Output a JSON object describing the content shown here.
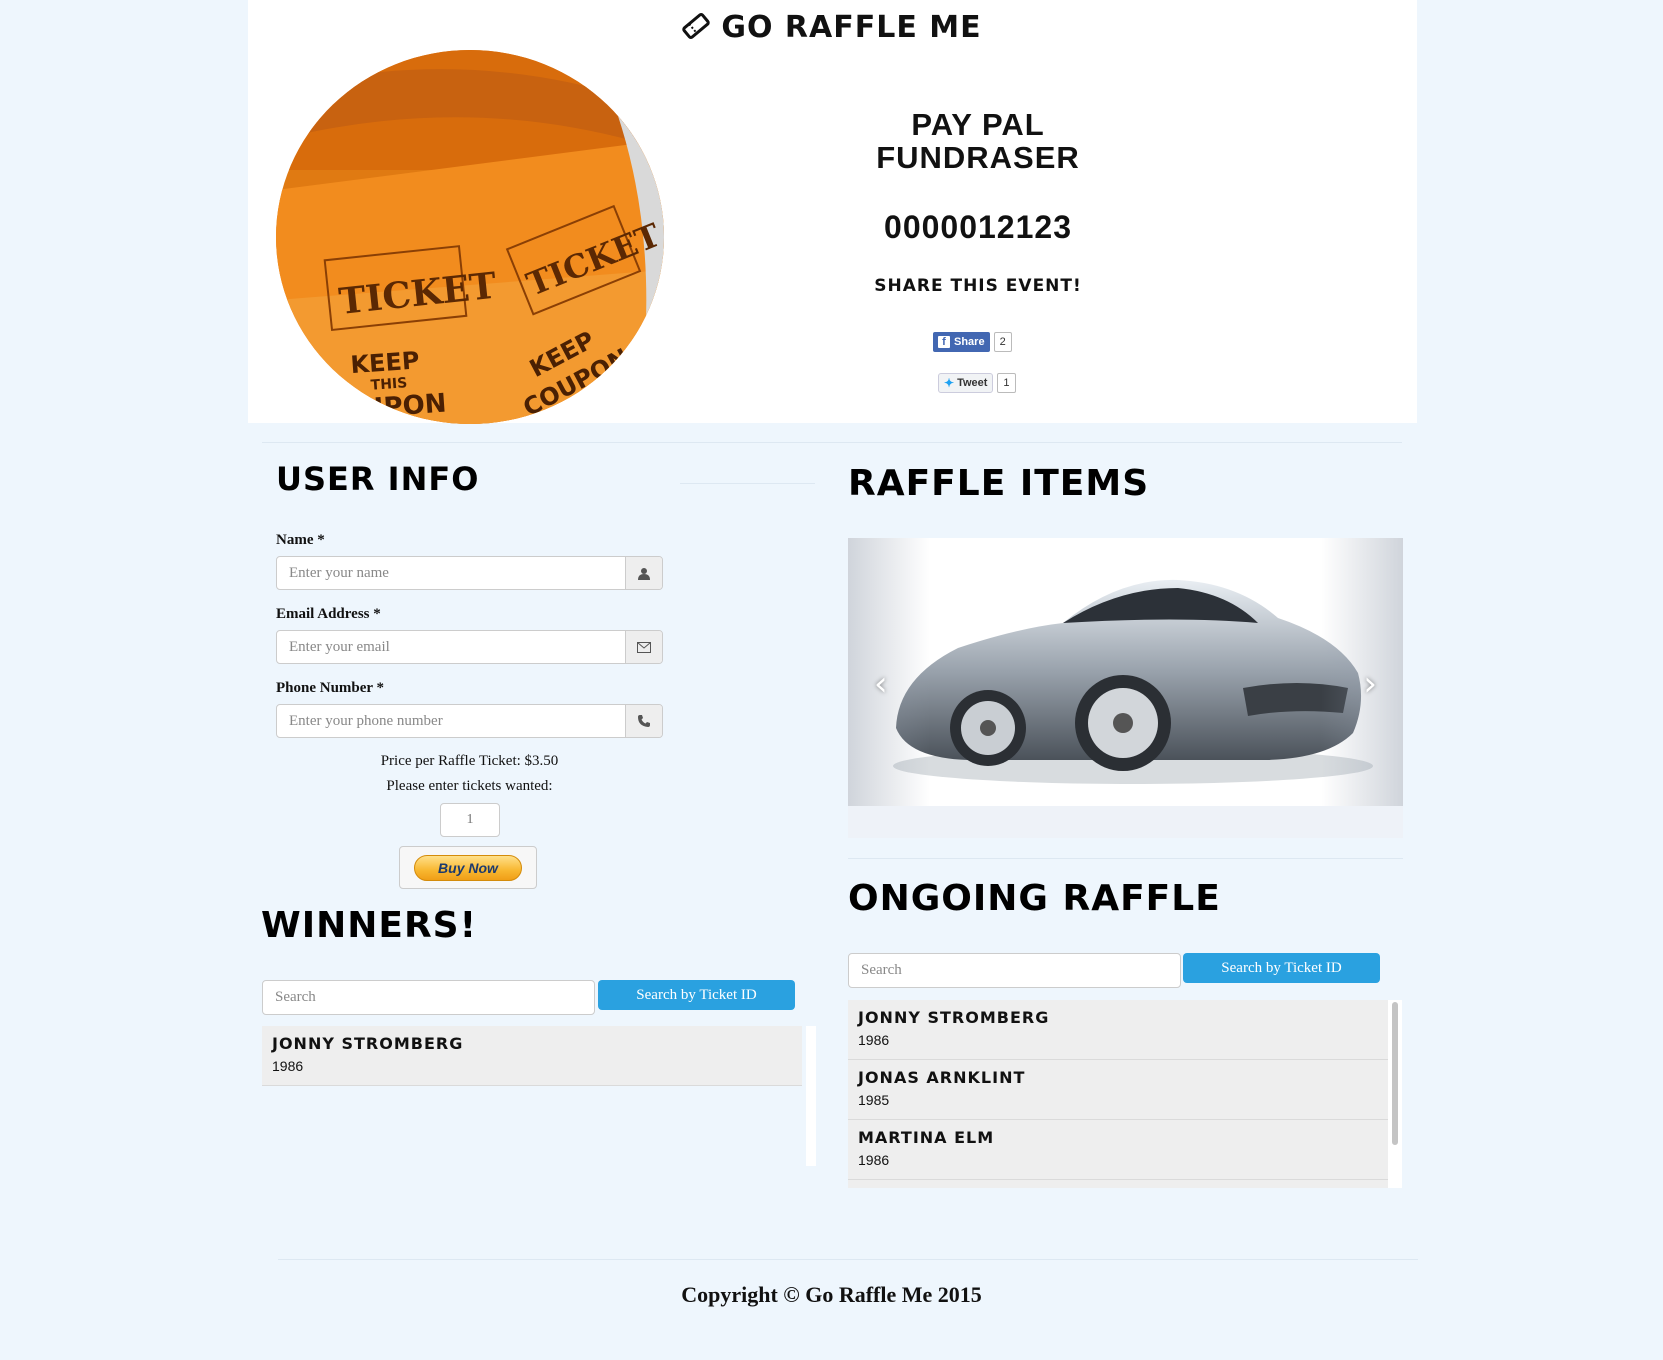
{
  "brand": {
    "name": "GO RAFFLE ME"
  },
  "event": {
    "title_line1": "PAY PAL",
    "title_line2": "FUNDRASER",
    "number": "0000012123",
    "share_heading": "SHARE THIS EVENT!",
    "share": {
      "label": "Share",
      "count": "2"
    },
    "tweet": {
      "label": "Tweet",
      "count": "1"
    }
  },
  "user_info": {
    "heading": "USER INFO",
    "name": {
      "label": "Name *",
      "placeholder": "Enter your name"
    },
    "email": {
      "label": "Email Address *",
      "placeholder": "Enter your email"
    },
    "phone": {
      "label": "Phone Number *",
      "placeholder": "Enter your phone number"
    },
    "price_text": "Price per Raffle Ticket: $3.50",
    "tickets_prompt": "Please enter tickets wanted:",
    "tickets_value": "1",
    "buy_label": "Buy Now"
  },
  "winners": {
    "heading": "WINNERS!",
    "search_placeholder": "Search",
    "search_button": "Search by Ticket ID",
    "items": [
      {
        "name": "JONNY STROMBERG",
        "year": "1986"
      }
    ]
  },
  "raffle_items": {
    "heading": "RAFFLE ITEMS"
  },
  "ongoing": {
    "heading": "ONGOING RAFFLE",
    "search_placeholder": "Search",
    "search_button": "Search by Ticket ID",
    "items": [
      {
        "name": "JONNY STROMBERG",
        "year": "1986"
      },
      {
        "name": "JONAS ARNKLINT",
        "year": "1985"
      },
      {
        "name": "MARTINA ELM",
        "year": "1986"
      }
    ]
  },
  "footer": {
    "text": "Copyright © Go Raffle Me 2015"
  },
  "colors": {
    "page_bg": "#eef6fd",
    "accent_blue": "#2aa1e0",
    "ticket_orange": "#f28c1e"
  }
}
